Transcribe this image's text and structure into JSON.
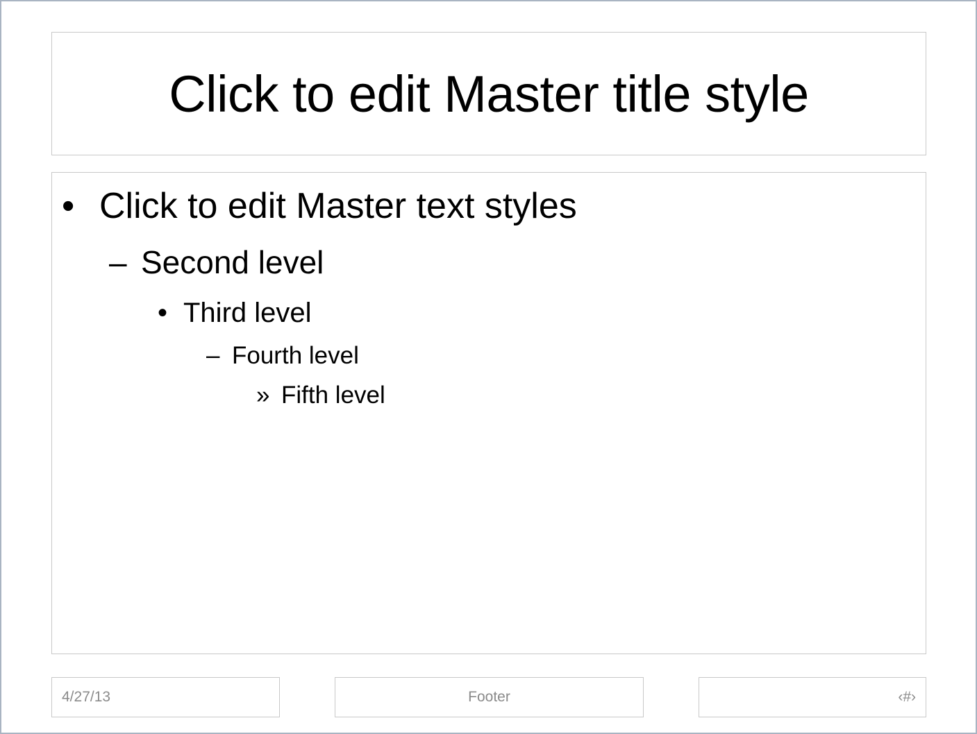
{
  "title": {
    "text": "Click to edit Master title style"
  },
  "body": {
    "levels": [
      {
        "bullet": "•",
        "text": "Click to edit Master text styles"
      },
      {
        "bullet": "–",
        "text": "Second level"
      },
      {
        "bullet": "•",
        "text": "Third level"
      },
      {
        "bullet": "–",
        "text": "Fourth level"
      },
      {
        "bullet": "»",
        "text": "Fifth level"
      }
    ]
  },
  "footer": {
    "date": "4/27/13",
    "text": "Footer",
    "slide_number": "‹#›"
  },
  "colors": {
    "frame_border": "#a9b4c2",
    "placeholder_border": "#c8c8c8",
    "footer_text": "#8a8a8a"
  }
}
